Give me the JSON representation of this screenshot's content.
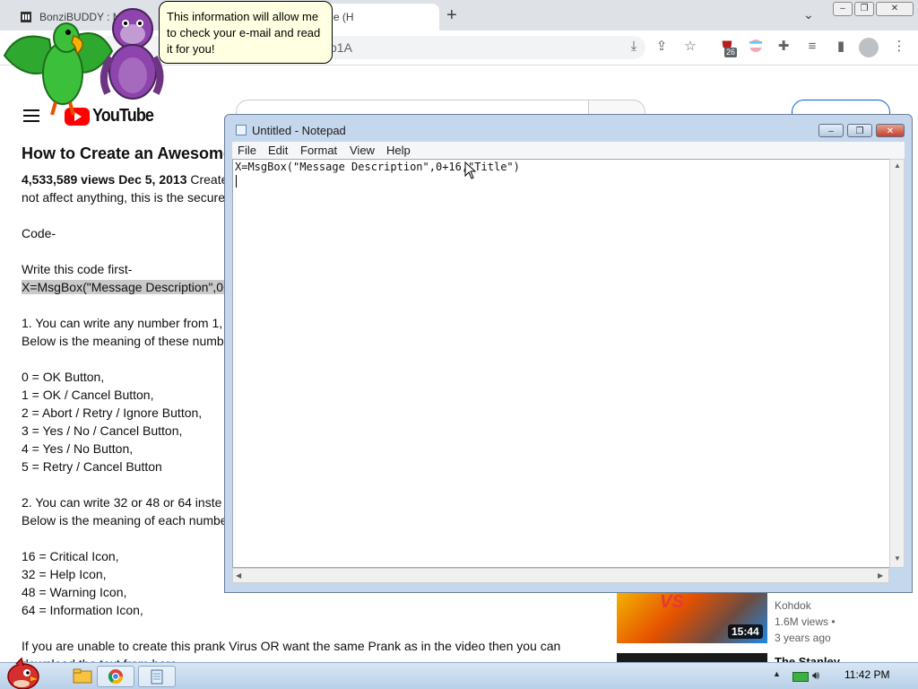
{
  "browser": {
    "tabs": [
      {
        "label": "BonziBUDDY : M"
      },
      {
        "label": "an Awesome (H"
      }
    ],
    "new_tab_glyph": "+",
    "address_fragment": "o1A",
    "extension_badge": "26",
    "window_controls": [
      "–",
      "❐",
      "✕"
    ]
  },
  "bonzi": {
    "speech": "This information will allow me to check your e-mail and read it for you!"
  },
  "youtube": {
    "logo_text": "YouTube",
    "video_title": "How to Create an Awesome",
    "description_lines": [
      {
        "text": "4,533,589 views  Dec 5, 2013  Create",
        "bold": true
      },
      {
        "text": "not affect anything, this is the secure"
      },
      {
        "text": ""
      },
      {
        "text": "Code-"
      },
      {
        "text": ""
      },
      {
        "text": "Write this code first-"
      },
      {
        "text": "X=MsgBox(\"Message Description\",0+",
        "highlight": true
      },
      {
        "text": ""
      },
      {
        "text": "1.  You can write any number from 1,"
      },
      {
        "text": "Below is the meaning of these numb"
      },
      {
        "text": ""
      },
      {
        "text": "0 = OK Button,"
      },
      {
        "text": "1 = OK / Cancel Button,"
      },
      {
        "text": "2 = Abort / Retry / Ignore Button,"
      },
      {
        "text": "3 = Yes / No / Cancel Button,"
      },
      {
        "text": "4 = Yes / No Button,"
      },
      {
        "text": "5 = Retry / Cancel Button"
      },
      {
        "text": ""
      },
      {
        "text": "2.  You can write 32 or 48 or 64 inste"
      },
      {
        "text": "Below is the meaning of each numbe"
      },
      {
        "text": ""
      },
      {
        "text": "16 = Critical Icon,"
      },
      {
        "text": "32 = Help Icon,"
      },
      {
        "text": "48 = Warning Icon,"
      },
      {
        "text": "64 = Information Icon,"
      },
      {
        "text": ""
      },
      {
        "text": "If you are unable to create this prank Virus OR want the same Prank as in the video then you can"
      },
      {
        "text": "download the text from here"
      }
    ],
    "recommended": [
      {
        "thumb_text": "VS",
        "duration": "15:44",
        "channel": "Kohdok",
        "views": "1.6M views •",
        "age": "3 years ago"
      },
      {
        "title": "The Stanley"
      }
    ]
  },
  "notepad": {
    "title": "Untitled - Notepad",
    "menu": [
      "File",
      "Edit",
      "Format",
      "View",
      "Help"
    ],
    "content": "X=MsgBox(\"Message Description\",0+16,\"Title\")",
    "controls": [
      "–",
      "❐",
      "✕"
    ]
  },
  "taskbar": {
    "clock": "11:42 PM"
  }
}
